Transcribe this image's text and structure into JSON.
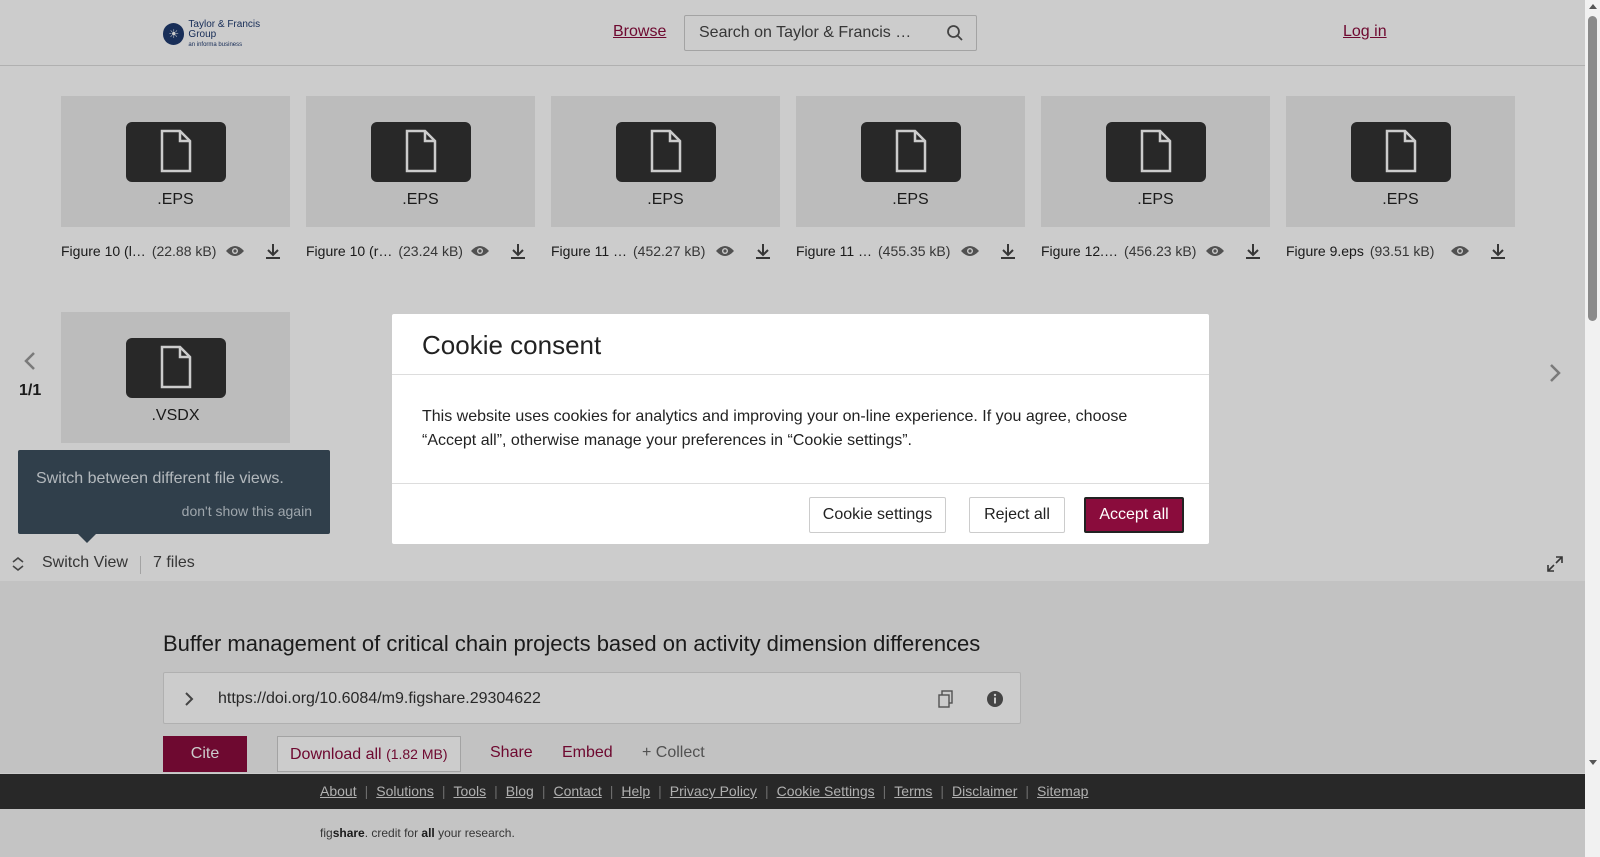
{
  "header": {
    "logo_line1": "Taylor & Francis Group",
    "logo_line2": "an informa business",
    "browse_label": "Browse",
    "search_placeholder": "Search on Taylor & Francis …",
    "login_label": "Log in"
  },
  "files": [
    {
      "ext": ".EPS",
      "name": "Figure 10 (l…",
      "size": "(22.88 kB)"
    },
    {
      "ext": ".EPS",
      "name": "Figure 10 (r…",
      "size": "(23.24 kB)"
    },
    {
      "ext": ".EPS",
      "name": "Figure 11 …",
      "size": "(452.27 kB)"
    },
    {
      "ext": ".EPS",
      "name": "Figure 11 …",
      "size": "(455.35 kB)"
    },
    {
      "ext": ".EPS",
      "name": "Figure 12.…",
      "size": "(456.23 kB)"
    },
    {
      "ext": ".EPS",
      "name": "Figure 9.eps",
      "size": "(93.51 kB)"
    },
    {
      "ext": ".VSDX",
      "name": "",
      "size": ""
    }
  ],
  "viewer": {
    "pager": "1/1",
    "tooltip_text": "Switch between different file views.",
    "tooltip_dismiss": "don't show this again",
    "switch_view_label": "Switch View",
    "files_count": "7 files"
  },
  "article": {
    "title": "Buffer management of critical chain projects based on activity dimension differences",
    "doi_url": "https://doi.org/10.6084/m9.figshare.29304622",
    "cite_label": "Cite",
    "download_label": "Download all",
    "download_size": "(1.82 MB)",
    "share_label": "Share",
    "embed_label": "Embed",
    "collect_label": "+ Collect"
  },
  "footer": {
    "links": [
      "About",
      "Solutions",
      "Tools",
      "Blog",
      "Contact",
      "Help",
      "Privacy Policy",
      "Cookie Settings",
      "Terms",
      "Disclaimer",
      "Sitemap"
    ],
    "tagline_fig": "fig",
    "tagline_share": "share",
    "tagline_mid": ". credit for ",
    "tagline_all": "all",
    "tagline_end": " your research."
  },
  "cookie_modal": {
    "title": "Cookie consent",
    "body": "This website uses cookies for analytics and improving your on-line experience. If you agree, choose “Accept all”, otherwise manage your preferences in “Cookie settings”.",
    "settings_label": "Cookie settings",
    "reject_label": "Reject all",
    "accept_label": "Accept all"
  },
  "colors": {
    "brand": "#8a0c3c",
    "tooltip_bg": "#3d4f5e",
    "footer_bg": "#333333"
  }
}
